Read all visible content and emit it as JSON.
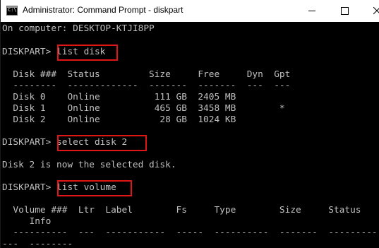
{
  "window": {
    "title": "Administrator: Command Prompt - diskpart"
  },
  "console": {
    "l01": "On computer: DESKTOP-KTJI8PP",
    "l02": "DISKPART> list disk",
    "l03": "  Disk ###  Status         Size     Free     Dyn  Gpt",
    "l04": "  --------  -------------  -------  -------  ---  ---",
    "l05": "  Disk 0    Online          111 GB  2405 MB",
    "l06": "  Disk 1    Online          465 GB  3458 MB        *",
    "l07": "  Disk 2    Online           28 GB  1024 KB",
    "l08": "DISKPART> select disk 2",
    "l09": "Disk 2 is now the selected disk.",
    "l10": "DISKPART> list volume",
    "l11": "  Volume ###  Ltr  Label        Fs     Type        Size     Status",
    "l12": "     Info",
    "l13": "  ----------  ---  -----------  -----  ----------  -------  ---------",
    "l14": "---  --------"
  },
  "colors": {
    "background": "#000000",
    "text": "#c0c0c0",
    "highlight": "#e01515",
    "titlebar": "#ffffff"
  },
  "icons": {
    "app": "cmd-icon",
    "minimize": "minimize-icon",
    "maximize": "maximize-icon",
    "close": "close-icon"
  }
}
